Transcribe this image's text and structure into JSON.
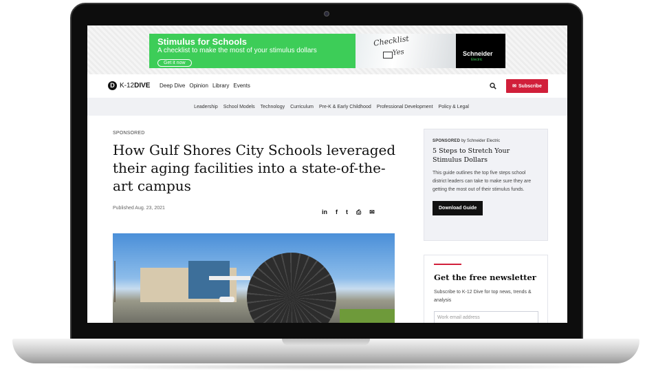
{
  "ad": {
    "title": "Stimulus for Schools",
    "subtitle": "A checklist to make the most of your stimulus dollars",
    "cta": "Get it now",
    "photo_text_1": "Checklist",
    "photo_text_2": "Yes",
    "brand": "Schneider",
    "brand_sub": "Electric",
    "accent_color": "#3dcd58"
  },
  "nav": {
    "logo_prefix": "K-12",
    "logo_bold": "DIVE",
    "links": [
      "Deep Dive",
      "Opinion",
      "Library",
      "Events"
    ],
    "search_icon": "search-icon",
    "subscribe_label": "Subscribe",
    "subscribe_color": "#d11f3a"
  },
  "topics": [
    "Leadership",
    "School Models",
    "Technology",
    "Curriculum",
    "Pre-K & Early Childhood",
    "Professional Development",
    "Policy & Legal"
  ],
  "article": {
    "label": "SPONSORED",
    "headline": "How Gulf Shores City Schools leveraged their aging facilities into a state-of-the-art campus",
    "published": "Published Aug. 23, 2021",
    "share_icons": [
      "linkedin-icon",
      "facebook-icon",
      "twitter-icon",
      "print-icon",
      "email-icon"
    ],
    "share_glyphs": [
      "in",
      "f",
      "t",
      "⎙",
      "✉"
    ]
  },
  "sidebar": {
    "sponsored": "SPONSORED",
    "sponsor": "by Schneider Electric",
    "title": "5 Steps to Stretch Your Stimulus Dollars",
    "desc": "This guide outlines the top five steps school district leaders can take to make sure they are getting the most out of their stimulus funds.",
    "button": "Download Guide"
  },
  "newsletter": {
    "title": "Get the free newsletter",
    "desc": "Subscribe to K-12 Dive for top news, trends & analysis",
    "placeholder": "Work email address"
  }
}
